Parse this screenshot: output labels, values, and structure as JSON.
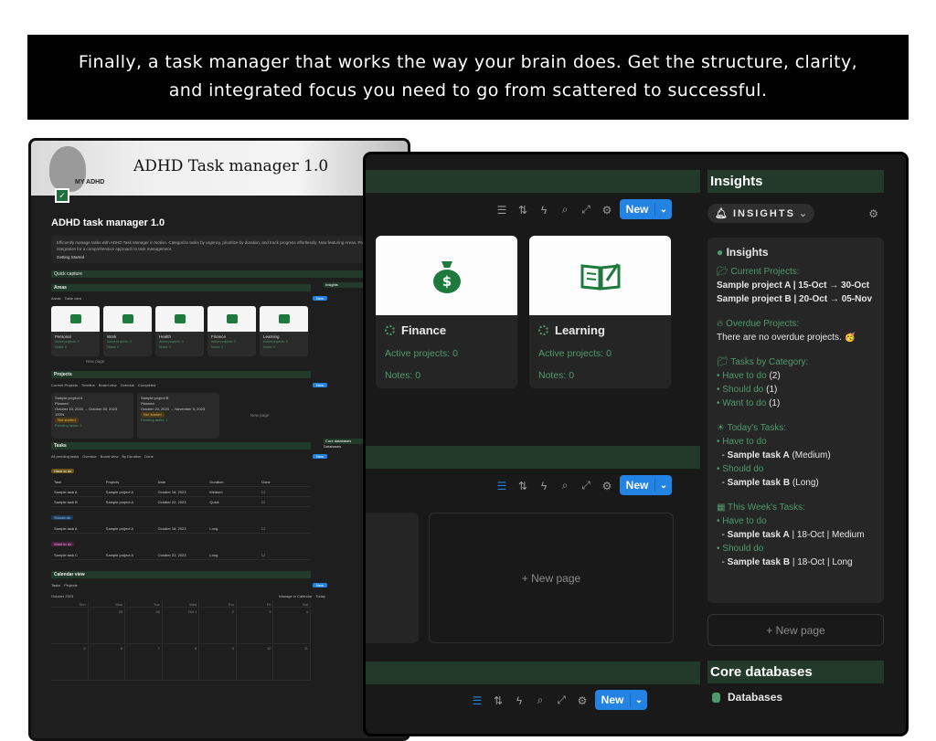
{
  "banner": {
    "line1": "Finally, a task manager that works the way your brain does. Get the structure, clarity,",
    "line2": "and integrated focus you need to go from scattered to successful."
  },
  "back_window": {
    "cover_title": "ADHD Task manager 1.0",
    "cover_subtitle": "MY ADHD",
    "page_title": "ADHD task manager 1.0",
    "callout_text": "Efficiently manage tasks with ADHD Task Manager in Notion. Categorize tasks by urgency, prioritize by duration, and track progress effortlessly. Now featuring Areas, Projects and notes integration for a comprehensive approach to task management.",
    "callout_link": "Getting Started",
    "quick_capture": "Quick capture",
    "areas_title": "Areas",
    "areas_views": [
      "Areas",
      "Table view"
    ],
    "areas": [
      {
        "name": "Personal",
        "active": "Active projects: 0",
        "notes": "Notes: 0"
      },
      {
        "name": "Work",
        "active": "Active projects: 0",
        "notes": "Notes: 0"
      },
      {
        "name": "Health",
        "active": "Active projects: 0",
        "notes": "Notes: 0"
      },
      {
        "name": "Finance",
        "active": "Active projects: 0",
        "notes": "Notes: 0"
      },
      {
        "name": "Learning",
        "active": "Active projects: 0",
        "notes": "Notes: 0"
      }
    ],
    "new_page": "New page",
    "projects_title": "Projects",
    "projects_views": [
      "Current Projects",
      "Timeline",
      "Board view",
      "Overdue",
      "Completed"
    ],
    "projects": [
      {
        "name": "Sample project A",
        "status": "Planned",
        "dates": "October 15, 2023 → October 30, 2023",
        "progress": "100%",
        "tag": "Not started",
        "tasks": "Pending tasks: 1"
      },
      {
        "name": "Sample project B",
        "status": "Planned",
        "dates": "October 20, 2023 → November 5, 2023",
        "progress": "",
        "tag": "Not started",
        "tasks": "Pending tasks: 1"
      }
    ],
    "tasks_title": "Tasks",
    "tasks_views": [
      "All pending tasks",
      "Overdue",
      "Board view",
      "By Duration",
      "Done"
    ],
    "task_groups": [
      {
        "name": "Have to do",
        "rows": [
          {
            "task": "Sample task A",
            "project": "Sample project A",
            "date": "October 18, 2023",
            "duration": "Medium"
          },
          {
            "task": "Sample task B",
            "project": "Sample project A",
            "date": "October 22, 2023",
            "duration": "Quick"
          }
        ]
      },
      {
        "name": "Should do",
        "rows": [
          {
            "task": "Sample task A",
            "project": "Sample project A",
            "date": "October 18, 2023",
            "duration": "Long"
          }
        ]
      },
      {
        "name": "Want to do",
        "rows": [
          {
            "task": "Sample task C",
            "project": "Sample project A",
            "date": "October 22, 2023",
            "duration": "Long"
          }
        ]
      }
    ],
    "table_headers": [
      "Task",
      "Projects",
      "Date",
      "Duration",
      "Done"
    ],
    "calendar_title": "Calendar view",
    "calendar_views": [
      "Tasks",
      "Projects"
    ],
    "calendar_month": "October 2023",
    "calendar_controls": [
      "Manage in Calendar",
      "Today"
    ],
    "calendar_days": [
      "Sun",
      "Mon",
      "Tue",
      "Wed",
      "Thu",
      "Fri",
      "Sat"
    ],
    "calendar_dates": [
      "",
      "25",
      "26",
      "Oct 1",
      "2",
      "3",
      "4",
      "5",
      "6",
      "7",
      "8",
      "9",
      "10",
      "11"
    ],
    "side_insights": "Insights",
    "side_core": "Core databases",
    "side_db": "Databases",
    "new_label": "New"
  },
  "front_window": {
    "area_cards": [
      {
        "name": "Finance",
        "active": "Active projects: 0",
        "notes": "Notes: 0"
      },
      {
        "name": "Learning",
        "active": "Active projects: 0",
        "notes": "Notes: 0"
      }
    ],
    "new_label": "New",
    "new_page": "+ New page",
    "insights_header": "Insights",
    "insights_pill": "INSIGHTS",
    "insights": {
      "heading": "Insights",
      "current_label": "Current Projects:",
      "current": [
        "Sample project A | 15-Oct → 30-Oct",
        "Sample project B | 20-Oct → 05-Nov"
      ],
      "overdue_label": "Overdue Projects:",
      "overdue_text": "There are no overdue projects. 🥳",
      "category_label": "Tasks by Category:",
      "categories": [
        {
          "name": "Have to do",
          "count": "(2)"
        },
        {
          "name": "Should do",
          "count": "(1)"
        },
        {
          "name": "Want to do",
          "count": "(1)"
        }
      ],
      "today_label": "Today's Tasks:",
      "today": [
        {
          "group": "Have to do",
          "task": "Sample task A",
          "detail": "(Medium)"
        },
        {
          "group": "Should do",
          "task": "Sample task B",
          "detail": "(Long)"
        }
      ],
      "week_label": "This Week's Tasks:",
      "week": [
        {
          "group": "Have to do",
          "task": "Sample task A",
          "detail": "| 18-Oct | Medium"
        },
        {
          "group": "Should do",
          "task": "Sample task B",
          "detail": "| 18-Oct | Long"
        }
      ]
    },
    "right_new_page": "+ New page",
    "core_header": "Core databases",
    "databases": "Databases"
  },
  "colors": {
    "accent_green": "#4e9a6b",
    "header_green": "#233a2a",
    "button_blue": "#2383e2"
  }
}
